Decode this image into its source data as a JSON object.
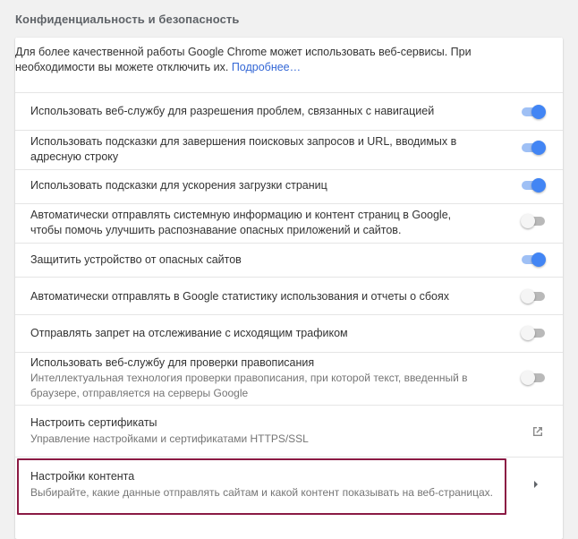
{
  "section": {
    "title": "Конфиденциальность и безопасность"
  },
  "intro": {
    "text": "Для более качественной работы Google Chrome может использовать веб-сервисы. При необходимости вы можете отключить их.",
    "link": "Подробнее…"
  },
  "settings": [
    {
      "label": "Использовать веб-службу для разрешения проблем, связанных с навигацией",
      "state": "on"
    },
    {
      "label": "Использовать подсказки для завершения поисковых запросов и URL, вводимых в адресную строку",
      "state": "on"
    },
    {
      "label": "Использовать подсказки для ускорения загрузки страниц",
      "state": "on"
    },
    {
      "label": "Автоматически отправлять системную информацию и контент страниц в Google, чтобы помочь улучшить распознавание опасных приложений и сайтов.",
      "state": "off"
    },
    {
      "label": "Защитить устройство от опасных сайтов",
      "state": "on"
    },
    {
      "label": "Автоматически отправлять в Google статистику использования и отчеты о сбоях",
      "state": "off"
    },
    {
      "label": "Отправлять запрет на отслеживание с исходящим трафиком",
      "state": "off"
    },
    {
      "label": "Использовать веб-службу для проверки правописания",
      "sub": "Интеллектуальная технология проверки правописания, при которой текст, введенный в браузере, отправляется на серверы Google",
      "state": "off"
    }
  ],
  "certificates": {
    "label": "Настроить сертификаты",
    "sub": "Управление настройками и сертификатами HTTPS/SSL",
    "icon": "external-link-icon"
  },
  "content_settings": {
    "label": "Настройки контента",
    "sub": "Выбирайте, какие данные отправлять сайтам и какой контент показывать на веб-страницах.",
    "icon": "chevron-right-icon"
  },
  "colors": {
    "toggle_on": "#4285f4",
    "toggle_on_track": "#9fc0f5",
    "toggle_off_track": "#b9b9b9",
    "link": "#3367d6",
    "highlight_border": "#8b1a44"
  }
}
